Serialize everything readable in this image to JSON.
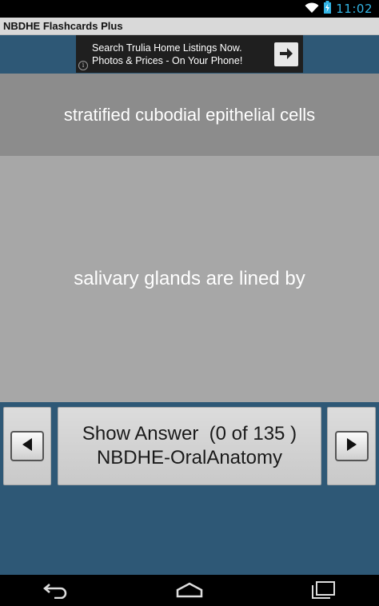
{
  "status": {
    "time": "11:02",
    "icons": [
      "wifi-icon",
      "battery-charging-icon"
    ]
  },
  "app": {
    "title": "NBDHE Flashcards Plus"
  },
  "ad": {
    "line1": "Search Trulia Home Listings Now.",
    "line2": "Photos & Prices - On Your Phone!",
    "info_glyph": "i",
    "arrow_icon": "arrow-right-icon"
  },
  "card": {
    "answer": "stratified cubodial epithelial cells",
    "question": "salivary glands are lined by"
  },
  "controls": {
    "show_answer": "Show Answer  (0 of 135 )",
    "deck": "NBDHE-OralAnatomy",
    "prev_icon": "triangle-left-icon",
    "next_icon": "triangle-right-icon"
  },
  "nav": {
    "icons": [
      "back-icon",
      "home-icon",
      "recents-icon"
    ]
  },
  "colors": {
    "accent_blue": "#2e5876",
    "answer_bg": "#8c8c8c",
    "question_bg": "#a7a7a7",
    "clock": "#33b5e5"
  }
}
